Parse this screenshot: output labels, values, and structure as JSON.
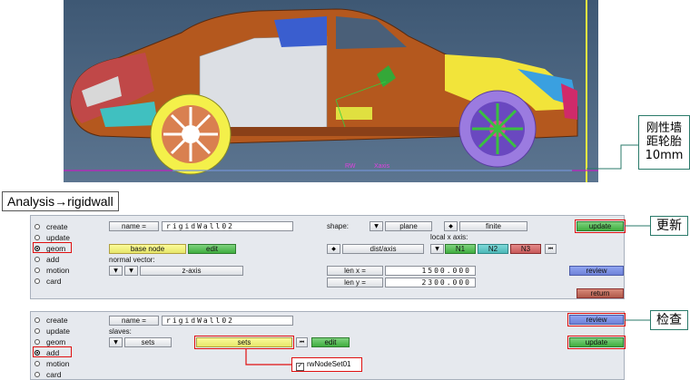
{
  "callout_tire": "刚性墙\n距轮胎\n10mm",
  "callout_tire_lines": [
    "刚性墙",
    "距轮胎",
    "10mm"
  ],
  "viewport": {
    "rw_label": "RW",
    "xaxis_label": "Xaxis"
  },
  "path_label": "Analysis→rigidwall",
  "panel1": {
    "radios": [
      "create",
      "update",
      "geom",
      "add",
      "motion",
      "card"
    ],
    "selected": "geom",
    "name_label": "name =",
    "name_value": "rigidWall02",
    "base_node": "base node",
    "edit": "edit",
    "normal_vector": "normal vector:",
    "zaxis": "z-axis",
    "shape_label": "shape:",
    "plane": "plane",
    "finite": "finite",
    "local_x_axis": "local x axis:",
    "dist_axis": "dist/axis",
    "n1": "N1",
    "n2": "N2",
    "n3": "N3",
    "lenx_label": "len x =",
    "lenx_value": "1500.000",
    "leny_label": "len y =",
    "leny_value": "2300.000",
    "update": "update",
    "review": "review",
    "return": "return"
  },
  "callout_update": "更新",
  "panel2": {
    "radios": [
      "create",
      "update",
      "geom",
      "add",
      "motion",
      "card"
    ],
    "selected": "add",
    "name_label": "name =",
    "name_value": "rigidWall02",
    "slaves": "slaves:",
    "sets": "sets",
    "sets_btn": "sets",
    "edit": "edit",
    "review": "review",
    "update": "update",
    "dropdown_item": "rwNodeSet01"
  },
  "callout_check": "检查"
}
